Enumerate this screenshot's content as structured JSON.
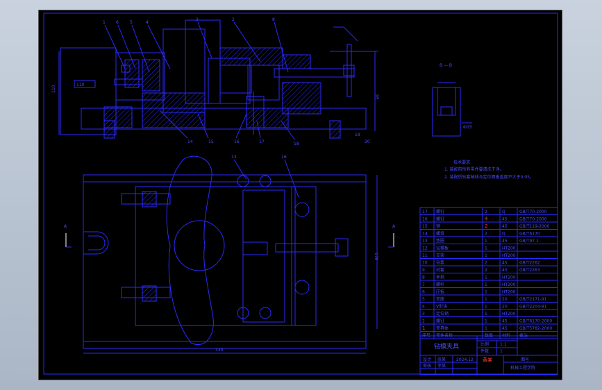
{
  "drawing": {
    "background": "#000000",
    "line_color": "#2a2aff",
    "accent_color": "#ff3b30",
    "title": "钻模夹具",
    "view_label_top": "B — B",
    "section_marks": [
      "A",
      "A"
    ],
    "tech_req": {
      "heading": "技术要求",
      "line1": "1. 装配前所有零件要清洗干净。",
      "line2": "2. 装配后钻套轴线与定位面垂直度不大于0.05。"
    },
    "balloons_top": [
      "1",
      "6",
      "5",
      "4",
      "3",
      "2",
      "8"
    ],
    "balloons_bottom": [
      "14",
      "15",
      "16",
      "17",
      "18",
      "19",
      "20"
    ],
    "dims": {
      "h_left": "110",
      "h_right": "95",
      "w_bottom": "330",
      "h_plan": "170"
    },
    "bom": {
      "rows": [
        {
          "no": "17",
          "name": "螺钉",
          "qty": "2",
          "mat": "Q",
          "std": "GB/T70-2000"
        },
        {
          "no": "16",
          "name": "螺钉",
          "qty": "4",
          "mat": "45",
          "std": "GB/T70-2000"
        },
        {
          "no": "15",
          "name": "销",
          "qty": "2",
          "mat": "45",
          "std": "GB/T119-2000"
        },
        {
          "no": "14",
          "name": "螺母",
          "qty": "2",
          "mat": "Q",
          "std": "GB/T6170"
        },
        {
          "no": "13",
          "name": "垫圈",
          "qty": "1",
          "mat": "45",
          "std": "GB/T97.1"
        },
        {
          "no": "12",
          "name": "钻模板",
          "qty": "1",
          "mat": "HT200",
          "std": ""
        },
        {
          "no": "11",
          "name": "支架",
          "qty": "1",
          "mat": "HT200",
          "std": ""
        },
        {
          "no": "10",
          "name": "钻套",
          "qty": "2",
          "mat": "45",
          "std": "GB/T2262"
        },
        {
          "no": "9",
          "name": "衬套",
          "qty": "2",
          "mat": "45",
          "std": "GB/T2263"
        },
        {
          "no": "8",
          "name": "手柄",
          "qty": "1",
          "mat": "HT200",
          "std": ""
        },
        {
          "no": "7",
          "name": "螺杆",
          "qty": "1",
          "mat": "HT200",
          "std": ""
        },
        {
          "no": "6",
          "name": "压板",
          "qty": "1",
          "mat": "HT200",
          "std": ""
        },
        {
          "no": "5",
          "name": "支座",
          "qty": "1",
          "mat": "20",
          "std": "GB/T2171-91"
        },
        {
          "no": "4",
          "name": "V形块",
          "qty": "1",
          "mat": "20",
          "std": "GB/T2204-91"
        },
        {
          "no": "3",
          "name": "定位销",
          "qty": "1",
          "mat": "HT200",
          "std": ""
        },
        {
          "no": "2",
          "name": "螺钉",
          "qty": "1",
          "mat": "45",
          "std": "GB/T6170-2000"
        },
        {
          "no": "1",
          "name": "夹具体",
          "qty": "1",
          "mat": "45",
          "std": "GB/T5782-2000"
        }
      ],
      "header": {
        "no": "序号",
        "name": "零件名称",
        "qty": "数量",
        "mat": "材料",
        "std": "备注"
      },
      "title_block": {
        "name": "钻模夹具",
        "ratio_label": "比例",
        "ratio": "1:1",
        "sheet_label": "件数",
        "sheet": "1",
        "designer_label": "设计",
        "designer": "张某",
        "date": "2024.12",
        "checker_label": "审核",
        "checker": "李某",
        "school": "机械工程学院",
        "drawing_no_label": "图号",
        "red_mark": "黄某"
      }
    }
  }
}
